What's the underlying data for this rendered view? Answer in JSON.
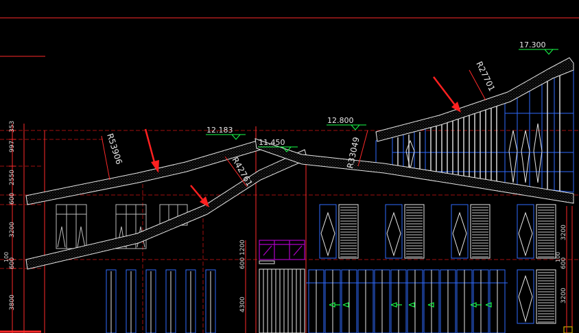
{
  "drawing": {
    "background": "#000000",
    "colors": {
      "red_line": "#ff2a2a",
      "dark_red": "#a01010",
      "white": "#ffffff",
      "grey": "#bdbdbd",
      "blue": "#2f6bff",
      "green": "#19ff4a",
      "purple": "#b000c8",
      "arrow": "#ff2020"
    },
    "radius_labels": {
      "r1": "R53906",
      "r2": "R42761",
      "r3": "R33049",
      "r4": "R27701"
    },
    "elevations": {
      "e1": "12.183",
      "e2": "11.450",
      "e3": "12.800",
      "e4": "17.300"
    },
    "left_dimensions": {
      "d1": "353",
      "d2": "997",
      "d3": "2550",
      "d4": "600",
      "d5": "3200",
      "d6": "100",
      "d7": "600",
      "d8": "3800"
    },
    "mid_dimensions": {
      "m1": "1200",
      "m2": "600",
      "m3": "4300"
    },
    "right_dimensions": {
      "r1": "3200",
      "r2": "100",
      "r3": "600",
      "r4": "3200"
    },
    "annotations": {
      "arrow_count": 3
    }
  }
}
